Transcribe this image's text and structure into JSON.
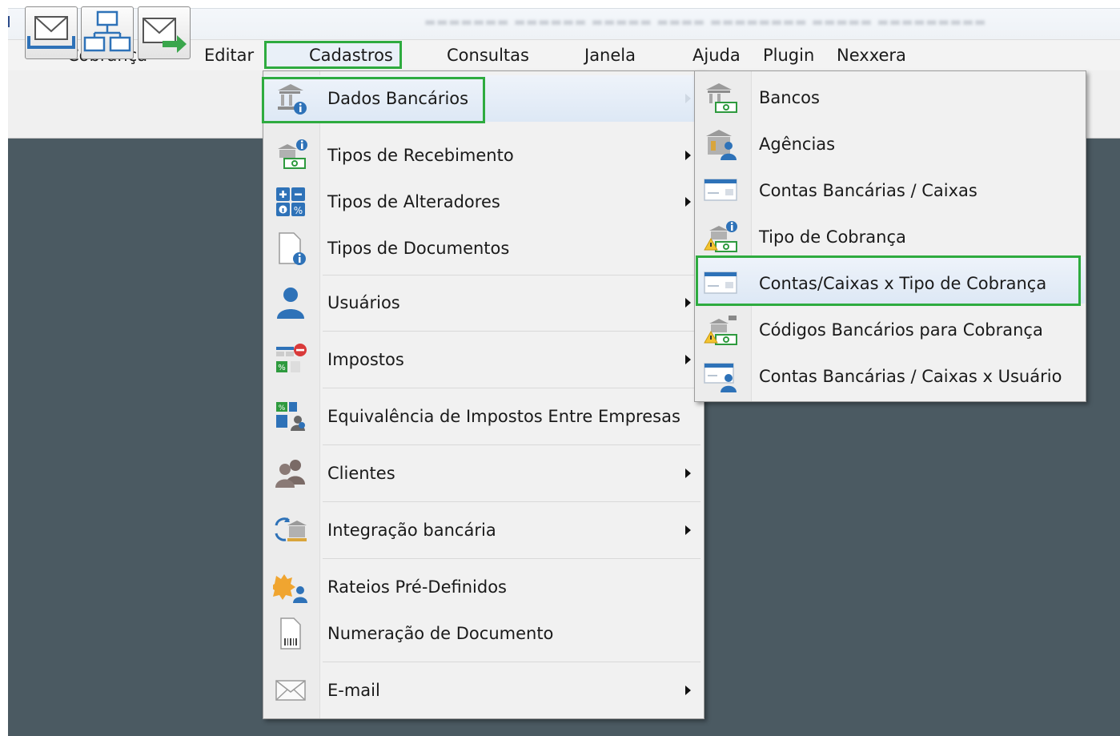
{
  "menubar": {
    "items": [
      "Cobrança",
      "Editar",
      "Cadastros",
      "Consultas",
      "Janela",
      "Ajuda",
      "Plugin",
      "Nexxera"
    ],
    "active": "Cadastros"
  },
  "toolbar": {
    "buttons": [
      {
        "icon": "envelope-tray-icon"
      },
      {
        "icon": "network-diagram-icon"
      },
      {
        "icon": "envelope-send-icon"
      }
    ]
  },
  "cadastros_menu": {
    "items": [
      {
        "label": "Dados Bancários",
        "icon": "bank-info-icon",
        "submenu": true,
        "highlighted": true
      },
      {
        "label": "Tipos de Recebimento",
        "icon": "money-receive-icon",
        "submenu": true
      },
      {
        "label": "Tipos de Alteradores",
        "icon": "calculator-icon",
        "submenu": true
      },
      {
        "label": "Tipos de Documentos",
        "icon": "document-info-icon",
        "submenu": false
      },
      {
        "label": "Usuários",
        "icon": "user-icon",
        "submenu": true
      },
      {
        "label": "Impostos",
        "icon": "tax-table-icon",
        "submenu": true
      },
      {
        "label": "Equivalência de Impostos Entre Empresas",
        "icon": "tax-equivalence-icon",
        "submenu": false
      },
      {
        "label": "Clientes",
        "icon": "clients-icon",
        "submenu": true
      },
      {
        "label": "Integração bancária",
        "icon": "bank-integration-icon",
        "submenu": true
      },
      {
        "label": "Rateios Pré-Definidos",
        "icon": "allocation-icon",
        "submenu": false
      },
      {
        "label": "Numeração de Documento",
        "icon": "document-barcode-icon",
        "submenu": false
      },
      {
        "label": "E-mail",
        "icon": "envelope-icon",
        "submenu": true
      }
    ]
  },
  "dados_bancarios_submenu": {
    "items": [
      {
        "label": "Bancos",
        "icon": "bank-money-icon"
      },
      {
        "label": "Agências",
        "icon": "bank-agency-icon"
      },
      {
        "label": "Contas Bancárias / Caixas",
        "icon": "bank-check-icon"
      },
      {
        "label": "Tipo de Cobrança",
        "icon": "charge-type-icon"
      },
      {
        "label": "Contas/Caixas x Tipo de Cobrança",
        "icon": "bank-check-icon",
        "highlighted": true
      },
      {
        "label": "Códigos Bancários para Cobrança",
        "icon": "bank-code-icon"
      },
      {
        "label": "Contas Bancárias / Caixas x Usuário",
        "icon": "bank-check-user-icon"
      }
    ]
  },
  "colors": {
    "highlight_border": "#2eab3f",
    "workspace": "#4b5a62",
    "menu_background": "#f1f1f1",
    "hover": "#dde8f5"
  }
}
